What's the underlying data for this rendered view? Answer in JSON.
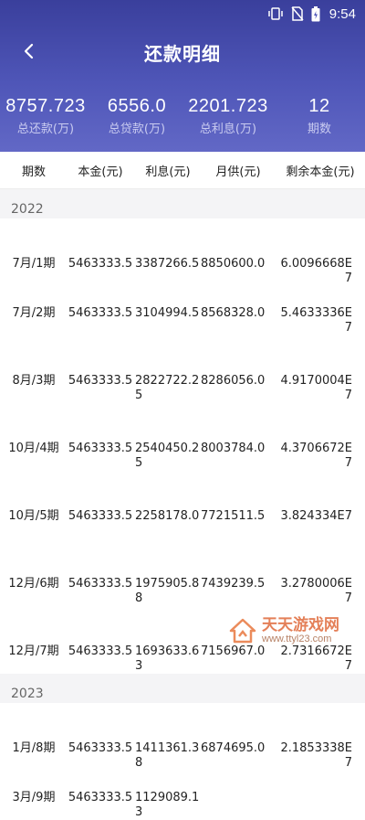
{
  "status_bar": {
    "time": "9:54"
  },
  "header": {
    "title": "还款明细"
  },
  "summary": [
    {
      "value": "8757.723",
      "label": "总还款(万)"
    },
    {
      "value": "6556.0",
      "label": "总贷款(万)"
    },
    {
      "value": "2201.723",
      "label": "总利息(万)"
    },
    {
      "value": "12",
      "label": "期数"
    }
  ],
  "columns": [
    "期数",
    "本金(元)",
    "利息(元)",
    "月供(元)",
    "剩余本金(元)"
  ],
  "years": [
    {
      "year": "2022",
      "rows": [
        {
          "period": "7月/1期",
          "principal": "5463333.5",
          "interest": "3387266.5",
          "monthly": "8850600.0",
          "remaining": "6.0096668E7"
        },
        {
          "period": "7月/2期",
          "principal": "5463333.5",
          "interest": "3104994.5",
          "monthly": "8568328.0",
          "remaining": "5.4633336E7"
        },
        {
          "period": "8月/3期",
          "principal": "5463333.5",
          "interest": "2822722.25",
          "monthly": "8286056.0",
          "remaining": "4.9170004E7"
        },
        {
          "period": "10月/4期",
          "principal": "5463333.5",
          "interest": "2540450.25",
          "monthly": "8003784.0",
          "remaining": "4.3706672E7"
        },
        {
          "period": "10月/5期",
          "principal": "5463333.5",
          "interest": "2258178.0",
          "monthly": "7721511.5",
          "remaining": "3.824334E7"
        },
        {
          "period": "12月/6期",
          "principal": "5463333.5",
          "interest": "1975905.88",
          "monthly": "7439239.5",
          "remaining": "3.2780006E7"
        },
        {
          "period": "12月/7期",
          "principal": "5463333.5",
          "interest": "1693633.63",
          "monthly": "7156967.0",
          "remaining": "2.7316672E7"
        }
      ]
    },
    {
      "year": "2023",
      "rows": [
        {
          "period": "1月/8期",
          "principal": "5463333.5",
          "interest": "1411361.38",
          "monthly": "6874695.0",
          "remaining": "2.1853338E7"
        },
        {
          "period": "3月/9期",
          "principal": "5463333.5",
          "interest": "1129089.13",
          "monthly": "",
          "remaining": ""
        }
      ]
    }
  ],
  "watermark": {
    "text": "天天游戏网",
    "url": "www.ttyl23.com"
  }
}
